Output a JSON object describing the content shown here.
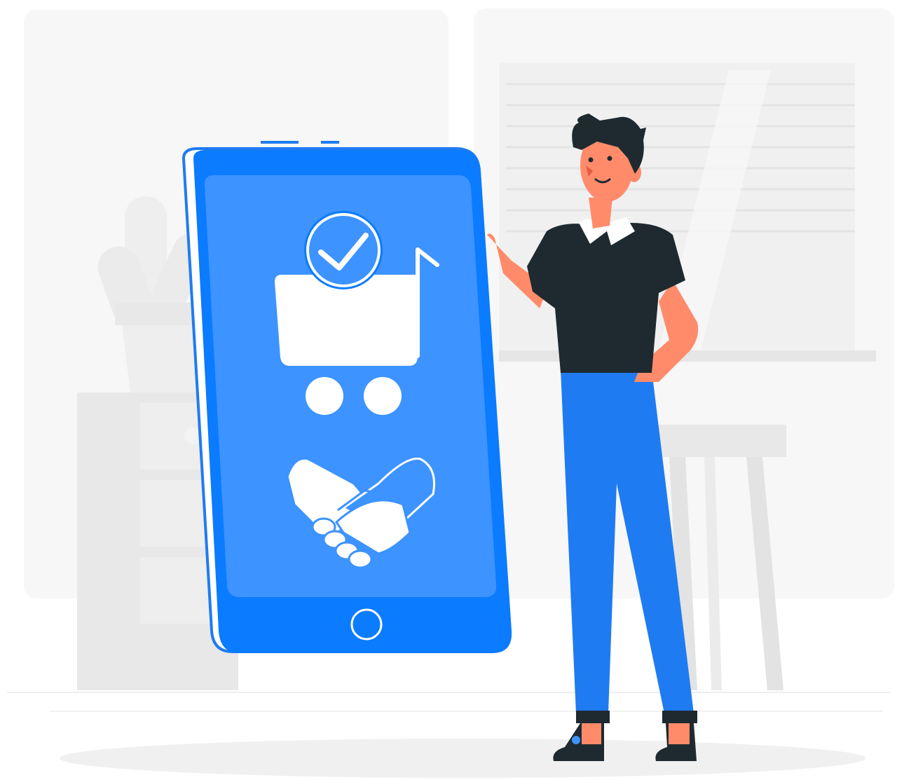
{
  "illustration": {
    "subject": "person-standing-beside-giant-smartphone",
    "icons": [
      "shopping-cart-icon",
      "checkmark-badge-icon",
      "handshake-icon",
      "home-button-icon"
    ]
  },
  "colors": {
    "phone_body": "#0b7bff",
    "phone_edge": "#2a86ff",
    "screen": "#3d93ff",
    "icon_fill": "#ffffff",
    "shirt": "#1e2a30",
    "pants": "#1f7bf2",
    "skin": "#ff8b6b",
    "hair": "#1e2a30",
    "background_shape": "#f4f4f4",
    "furniture": "#e8e8e8",
    "floor_shadow": "#f0f0f0"
  }
}
